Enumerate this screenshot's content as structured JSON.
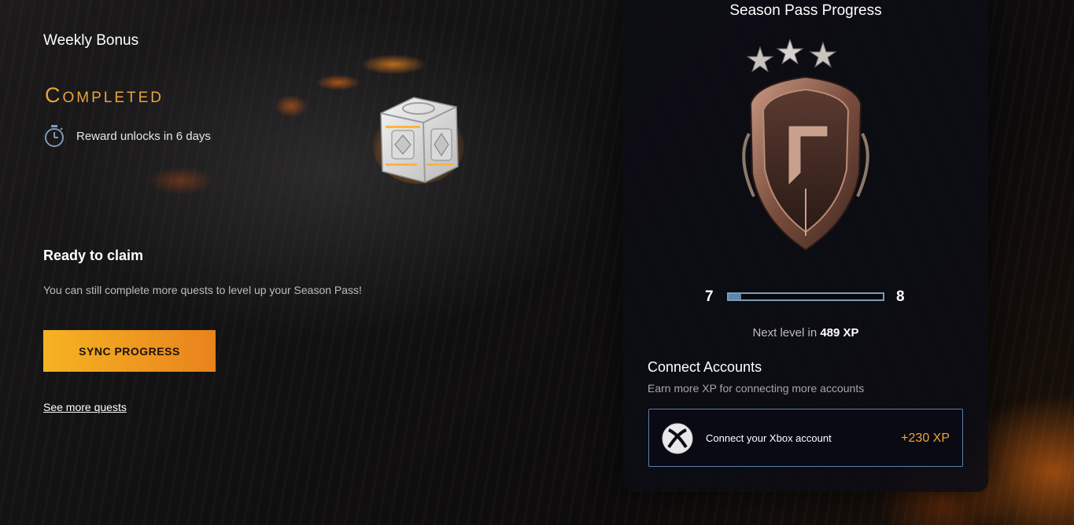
{
  "weekly_bonus": {
    "title": "Weekly Bonus",
    "status": "Completed",
    "timer_text": "Reward unlocks in 6 days"
  },
  "claim": {
    "title": "Ready to claim",
    "description": "You can still complete more quests to level up your Season Pass!",
    "sync_button": "SYNC PROGRESS",
    "see_more_link": "See more quests"
  },
  "season_pass": {
    "title": "Season Pass Progress",
    "current_level": "7",
    "next_level": "8",
    "progress_fraction": 0.08,
    "next_level_prefix": "Next level in",
    "next_level_xp": "489 XP"
  },
  "connect_accounts": {
    "title": "Connect Accounts",
    "subtitle": "Earn more XP for connecting more accounts",
    "xbox": {
      "label": "Connect your Xbox account",
      "xp": "+230 XP",
      "icon": "xbox-icon"
    }
  },
  "colors": {
    "accent_gold": "#e9a33b",
    "button_start": "#f6b323",
    "button_end": "#e8821d",
    "progress_blue": "#5b86ad",
    "card_border": "#5c7fa3"
  }
}
